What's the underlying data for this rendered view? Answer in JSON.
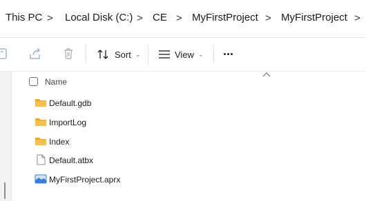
{
  "breadcrumb": {
    "items": [
      "This PC",
      "Local Disk (C:)",
      "CE",
      "MyFirstProject",
      "MyFirstProject"
    ],
    "separator": ">"
  },
  "toolbar": {
    "sort_label": "Sort",
    "view_label": "View",
    "more_label": "···"
  },
  "list": {
    "column_name": "Name",
    "files": [
      {
        "name": "Default.gdb",
        "icon": "folder-icon"
      },
      {
        "name": "ImportLog",
        "icon": "folder-icon"
      },
      {
        "name": "Index",
        "icon": "folder-icon"
      },
      {
        "name": "Default.atbx",
        "icon": "file-icon"
      },
      {
        "name": "MyFirstProject.aprx",
        "icon": "aprx-file-icon"
      }
    ]
  },
  "colors": {
    "folder": "#f6c14b",
    "folder_dark": "#e8a82a",
    "accent_blue": "#3a7fd5"
  }
}
